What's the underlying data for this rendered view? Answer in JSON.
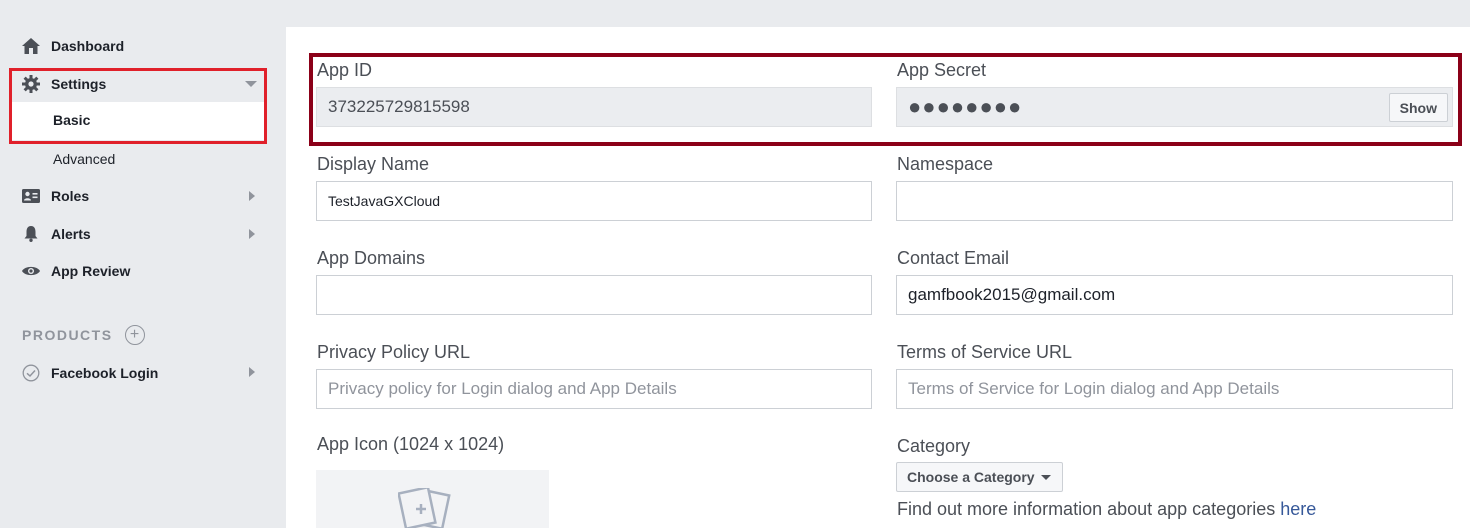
{
  "sidebar": {
    "items": [
      {
        "label": "Dashboard",
        "icon": "home-icon"
      },
      {
        "label": "Settings",
        "icon": "gear-icon"
      },
      {
        "label": "Roles",
        "icon": "roles-card-icon"
      },
      {
        "label": "Alerts",
        "icon": "bell-icon"
      },
      {
        "label": "App Review",
        "icon": "eye-icon"
      }
    ],
    "settings_sub": {
      "basic": "Basic",
      "advanced": "Advanced"
    },
    "products_label": "PRODUCTS",
    "products": [
      {
        "label": "Facebook Login",
        "icon": "check-circle-icon"
      }
    ]
  },
  "form": {
    "app_id": {
      "label": "App ID",
      "value": "373225729815598"
    },
    "app_secret": {
      "label": "App Secret",
      "value": "●●●●●●●●",
      "button": "Show"
    },
    "display_name": {
      "label": "Display Name",
      "value": "TestJavaGXCloud"
    },
    "namespace": {
      "label": "Namespace",
      "value": ""
    },
    "app_domains": {
      "label": "App Domains",
      "value": ""
    },
    "contact_email": {
      "label": "Contact Email",
      "value": "gamfbook2015@gmail.com"
    },
    "privacy_url": {
      "label": "Privacy Policy URL",
      "placeholder": "Privacy policy for Login dialog and App Details"
    },
    "tos_url": {
      "label": "Terms of Service URL",
      "placeholder": "Terms of Service for Login dialog and App Details"
    },
    "app_icon": {
      "label": "App Icon (1024 x 1024)"
    },
    "category": {
      "label": "Category",
      "button": "Choose a Category",
      "info": "Find out more information about app categories ",
      "link": "here"
    }
  },
  "colors": {
    "highlight_red": "#e0202a",
    "highlight_dark": "#8b0018",
    "link": "#365899"
  }
}
